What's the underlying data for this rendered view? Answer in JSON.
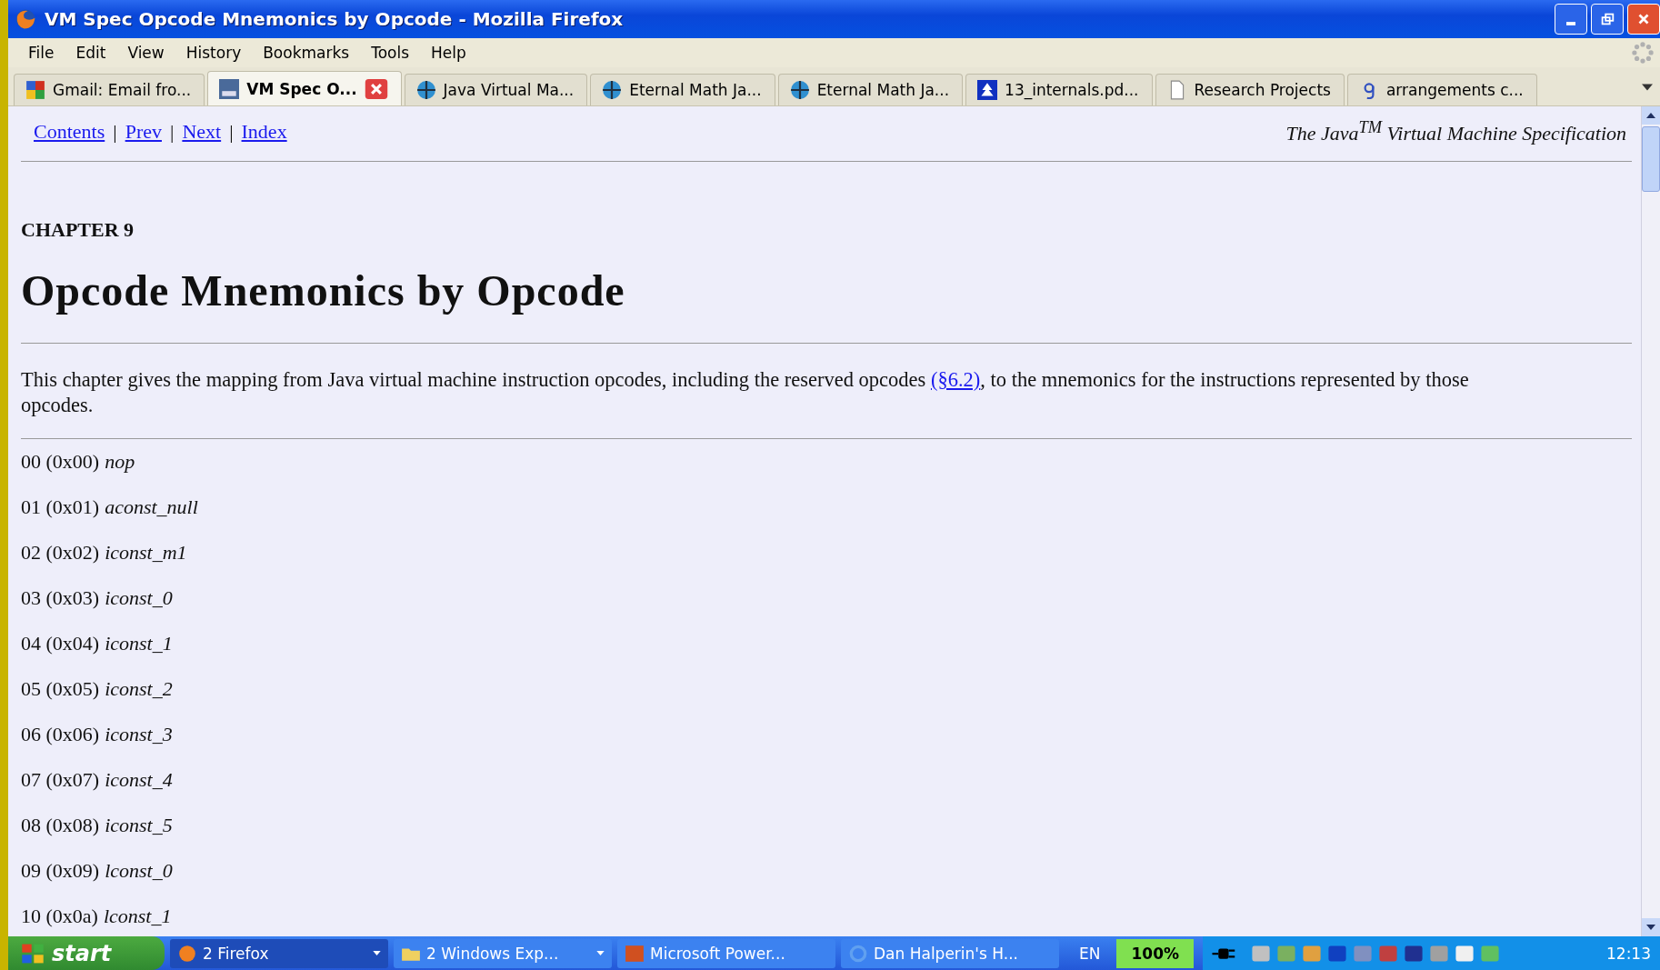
{
  "window": {
    "title": "VM Spec Opcode Mnemonics by Opcode - Mozilla Firefox"
  },
  "menu": [
    "File",
    "Edit",
    "View",
    "History",
    "Bookmarks",
    "Tools",
    "Help"
  ],
  "tabs": [
    {
      "label": "Gmail: Email fro...",
      "selected": false
    },
    {
      "label": "VM Spec O...",
      "selected": true
    },
    {
      "label": "Java Virtual Ma...",
      "selected": false
    },
    {
      "label": "Eternal Math Ja...",
      "selected": false
    },
    {
      "label": "Eternal Math Ja...",
      "selected": false
    },
    {
      "label": "13_internals.pd...",
      "selected": false
    },
    {
      "label": "Research Projects",
      "selected": false
    },
    {
      "label": "arrangements c...",
      "selected": false
    }
  ],
  "page": {
    "nav": [
      "Contents",
      "Prev",
      "Next",
      "Index"
    ],
    "separator": "|",
    "book_title": "The Java$^{TM}$ Virtual Machine Specification",
    "chapter": "CHAPTER 9",
    "heading": "Opcode Mnemonics by Opcode",
    "intro": {
      "before": "This chapter gives the mapping from Java virtual machine instruction opcodes, including the reserved opcodes",
      "link": "(§6.2)",
      "after": ", to the mnemonics for the instructions represented by those opcodes."
    },
    "opcodes": [
      {
        "code": "00 (0x00)",
        "mnemonic": "nop"
      },
      {
        "code": "01 (0x01)",
        "mnemonic": "aconst_null"
      },
      {
        "code": "02 (0x02)",
        "mnemonic": "iconst_m1"
      },
      {
        "code": "03 (0x03)",
        "mnemonic": "iconst_0"
      },
      {
        "code": "04 (0x04)",
        "mnemonic": "iconst_1"
      },
      {
        "code": "05 (0x05)",
        "mnemonic": "iconst_2"
      },
      {
        "code": "06 (0x06)",
        "mnemonic": "iconst_3"
      },
      {
        "code": "07 (0x07)",
        "mnemonic": "iconst_4"
      },
      {
        "code": "08 (0x08)",
        "mnemonic": "iconst_5"
      },
      {
        "code": "09 (0x09)",
        "mnemonic": "lconst_0"
      },
      {
        "code": "10 (0x0a)",
        "mnemonic": "lconst_1"
      }
    ]
  },
  "taskbar": {
    "start": "start",
    "tasks": [
      {
        "label": "2 Firefox",
        "selected": true
      },
      {
        "label": "2 Windows Exp...",
        "selected": false
      },
      {
        "label": "Microsoft Power...",
        "selected": false
      },
      {
        "label": "Dan Halperin's H...",
        "selected": false
      }
    ],
    "language": "EN",
    "battery": "100%",
    "clock": "12:13"
  }
}
